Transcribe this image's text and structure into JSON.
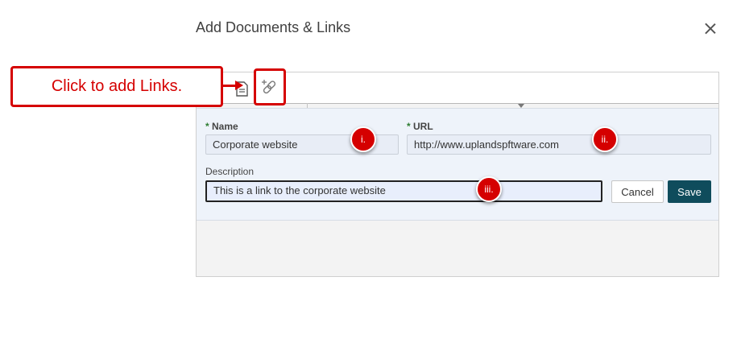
{
  "dialog": {
    "title": "Add Documents & Links",
    "close_icon": "close-icon"
  },
  "toolbar": {
    "add_document_icon": "document-icon",
    "add_link_icon": "add-link-icon"
  },
  "form": {
    "name": {
      "required_mark": "*",
      "label": "Name",
      "value": "Corporate website"
    },
    "url": {
      "required_mark": "*",
      "label": "URL",
      "value": "http://www.uplandspftware.com"
    },
    "description": {
      "label": "Description",
      "value": "This is a link to the corporate website"
    },
    "cancel_label": "Cancel",
    "save_label": "Save"
  },
  "annotations": {
    "callout_text": "Click to add Links.",
    "badges": [
      "i.",
      "ii.",
      "iii."
    ]
  },
  "colors": {
    "annotation_red": "#d50000",
    "save_button": "#0f4c5c",
    "required_mark": "#2e7d32",
    "form_background": "#eef3fa"
  }
}
